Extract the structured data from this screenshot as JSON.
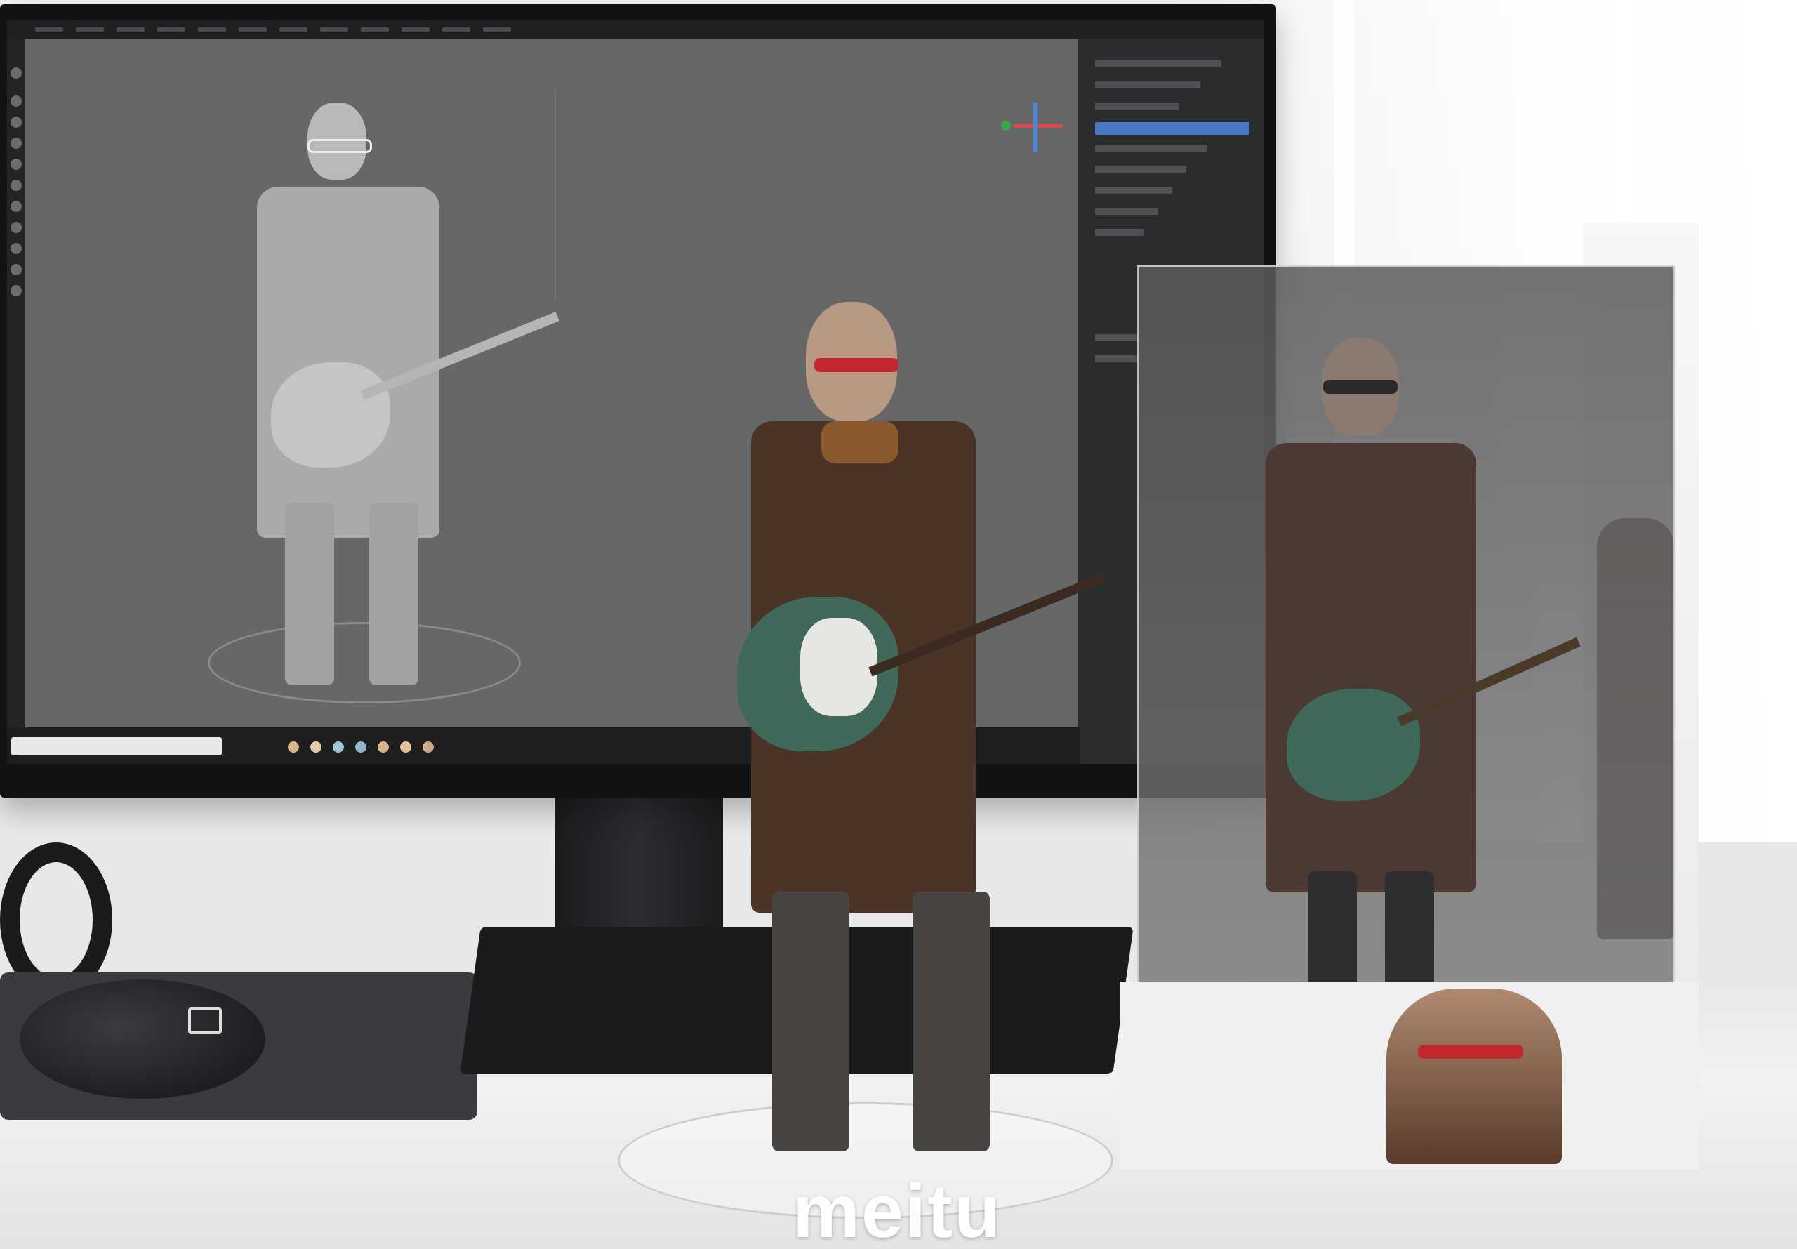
{
  "watermark": {
    "text": "meitu"
  },
  "colors": {
    "coat": "#4a3428",
    "guitar_body": "#3f6a5a",
    "glasses": "#c0282e",
    "viewport_bg": "#666769",
    "selection": "#4a78c4"
  },
  "icons": {
    "mouse_logo": "mouse-logo-icon",
    "axis_gizmo": "axis-gizmo-icon"
  }
}
